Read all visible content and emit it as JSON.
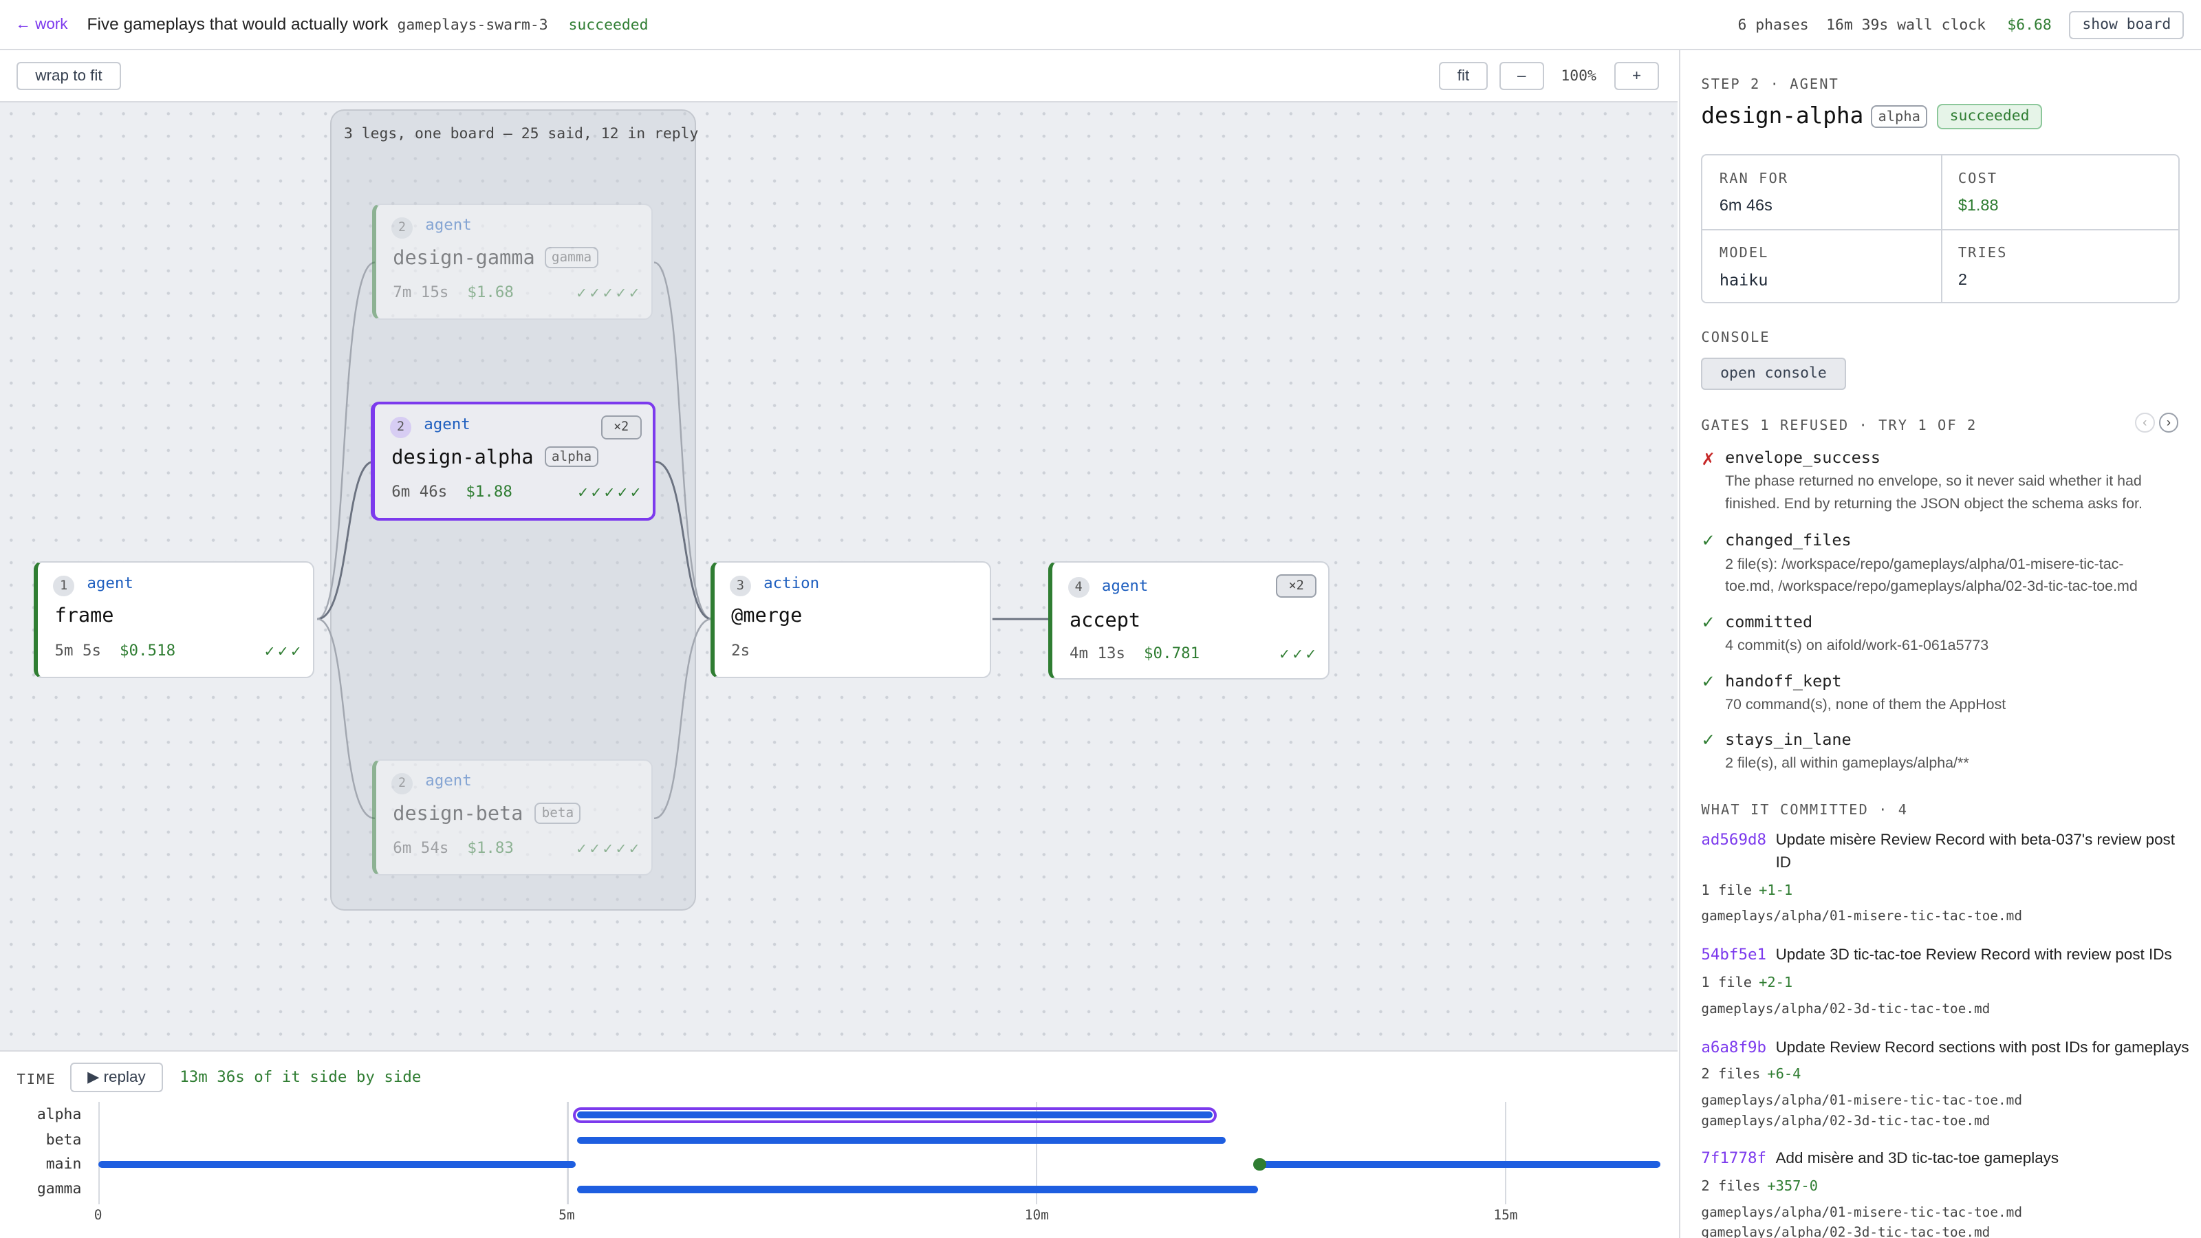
{
  "header": {
    "back": "← work",
    "title": "Five gameplays that would actually work",
    "run_id": "gameplays-swarm-3",
    "status": "succeeded",
    "phases": "6 phases",
    "wall": "16m 39s wall clock",
    "cost": "$6.68",
    "show_board": "show board"
  },
  "toolbar": {
    "wrap": "wrap to fit",
    "fit": "fit",
    "minus": "–",
    "zoom": "100%",
    "plus": "+"
  },
  "group": {
    "label": "3 legs, one board — 25 said, 12 in reply"
  },
  "nodes": {
    "frame": {
      "num": "1",
      "kind": "agent",
      "name": "frame",
      "time": "5m 5s",
      "cost": "$0.518",
      "checks": "✓✓✓"
    },
    "gamma": {
      "num": "2",
      "kind": "agent",
      "name": "design-gamma",
      "tag": "gamma",
      "time": "7m 15s",
      "cost": "$1.68",
      "checks": "✓✓✓✓✓"
    },
    "alpha": {
      "num": "2",
      "kind": "agent",
      "name": "design-alpha",
      "tag": "alpha",
      "mult": "×2",
      "time": "6m 46s",
      "cost": "$1.88",
      "checks": "✓✓✓✓✓"
    },
    "beta": {
      "num": "2",
      "kind": "agent",
      "name": "design-beta",
      "tag": "beta",
      "time": "6m 54s",
      "cost": "$1.83",
      "checks": "✓✓✓✓✓"
    },
    "merge": {
      "num": "3",
      "kind": "action",
      "name": "@merge",
      "time": "2s"
    },
    "accept": {
      "num": "4",
      "kind": "agent",
      "name": "accept",
      "mult": "×2",
      "time": "4m 13s",
      "cost": "$0.781",
      "checks": "✓✓✓"
    }
  },
  "panel": {
    "step": "STEP 2 · AGENT",
    "title": "design-alpha",
    "tag": "alpha",
    "status": "succeeded",
    "stats": {
      "ran_for_label": "RAN FOR",
      "ran_for": "6m 46s",
      "cost_label": "COST",
      "cost": "$1.88",
      "model_label": "MODEL",
      "model": "haiku",
      "tries_label": "TRIES",
      "tries": "2"
    },
    "console_label": "CONSOLE",
    "open_console": "open console",
    "gates_label": "GATES 1 REFUSED · TRY 1 OF 2",
    "gates": [
      {
        "mark": "✗",
        "name": "envelope_success",
        "desc1": "The phase returned no envelope, so it never said whether it had",
        "desc2": "finished. End by returning the JSON object the schema asks for."
      },
      {
        "mark": "✓",
        "name": "changed_files",
        "desc1": "2 file(s): /workspace/repo/gameplays/alpha/01-misere-tic-tac-",
        "desc2": "toe.md, /workspace/repo/gameplays/alpha/02-3d-tic-tac-toe.md"
      },
      {
        "mark": "✓",
        "name": "committed",
        "desc1": "4 commit(s) on aifold/work-61-061a5773"
      },
      {
        "mark": "✓",
        "name": "handoff_kept",
        "desc1": "70 command(s), none of them the AppHost"
      },
      {
        "mark": "✓",
        "name": "stays_in_lane",
        "desc1": "2 file(s), all within gameplays/alpha/**"
      }
    ],
    "committed_label": "WHAT IT COMMITTED · 4",
    "commits": [
      {
        "sha": "ad569d8",
        "msg1": "Update misère Review Record with beta-037's review post",
        "msg2": "ID",
        "files": "1 file",
        "diff": "+1-1",
        "paths": [
          "gameplays/alpha/01-misere-tic-tac-toe.md"
        ]
      },
      {
        "sha": "54bf5e1",
        "msg1": "Update 3D tic-tac-toe Review Record with review post IDs",
        "files": "1 file",
        "diff": "+2-1",
        "paths": [
          "gameplays/alpha/02-3d-tic-tac-toe.md"
        ]
      },
      {
        "sha": "a6a8f9b",
        "msg1": "Update Review Record sections with post IDs for gameplays",
        "files": "2 files",
        "diff": "+6-4",
        "paths": [
          "gameplays/alpha/01-misere-tic-tac-toe.md",
          "gameplays/alpha/02-3d-tic-tac-toe.md"
        ]
      },
      {
        "sha": "7f1778f",
        "msg1": "Add misère and 3D tic-tac-toe gameplays",
        "files": "2 files",
        "diff": "+357-0",
        "paths": [
          "gameplays/alpha/01-misere-tic-tac-toe.md",
          "gameplays/alpha/02-3d-tic-tac-toe.md"
        ]
      }
    ]
  },
  "timeline": {
    "label": "TIME",
    "replay": "▶ replay",
    "summary": "13m 36s of it side by side",
    "lanes": [
      "alpha",
      "beta",
      "main",
      "gamma"
    ],
    "ticks": [
      "0",
      "5m",
      "10m",
      "15m"
    ]
  },
  "colors": {
    "accent": "#7c3aed",
    "success": "#2f7d32",
    "link": "#1f5fbf",
    "bar": "#1e5ee0",
    "refused": "#c62828"
  }
}
